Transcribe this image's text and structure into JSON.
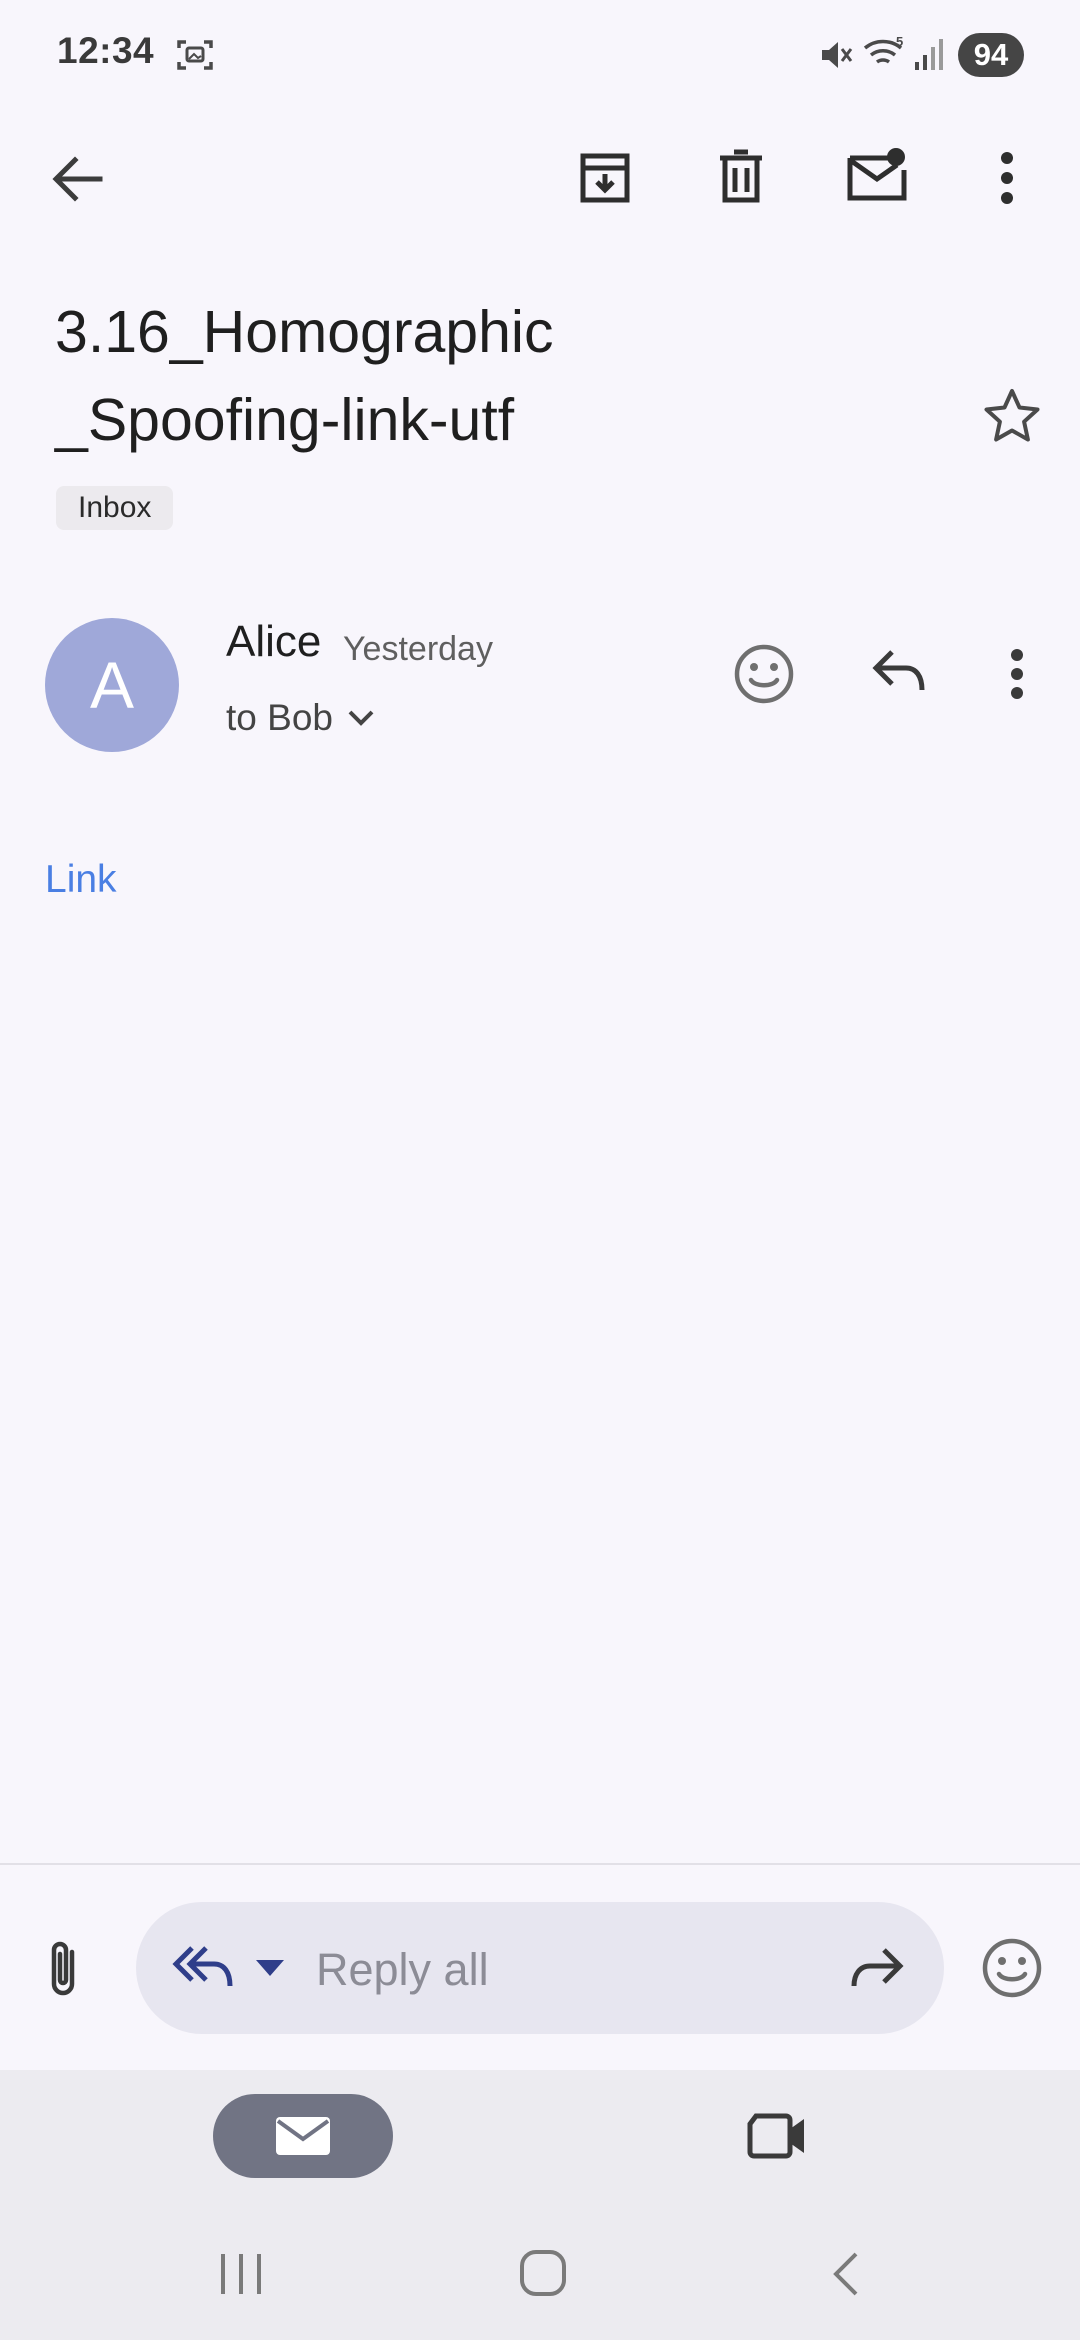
{
  "status_bar": {
    "time": "12:34",
    "battery": "94"
  },
  "toolbar": {
    "back_icon": "arrow-left-icon",
    "archive_icon": "archive-icon",
    "delete_icon": "trash-icon",
    "mark_unread_icon": "mail-unread-icon",
    "more_icon": "more-vert-icon"
  },
  "email": {
    "subject": "3.16_Homographic\n_Spoofing-link-utf",
    "label": "Inbox",
    "sender": {
      "initial": "A",
      "name": "Alice",
      "time": "Yesterday",
      "recipient": "to Bob"
    },
    "body_link": "Link"
  },
  "reply_bar": {
    "placeholder": "Reply all"
  },
  "colors": {
    "background": "#F8F6FC",
    "avatar": "#9FA8D9",
    "link": "#4A7FE3",
    "reply_pill": "#E7E6F0",
    "nav_area": "#ECEBF0",
    "mail_pill": "#717484"
  }
}
